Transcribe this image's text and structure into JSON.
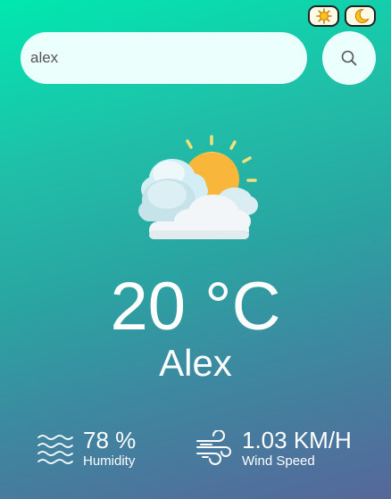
{
  "theme_toggle": {
    "light_icon": "sun-icon",
    "dark_icon": "moon-icon"
  },
  "search": {
    "value": "alex",
    "icon": "search-icon"
  },
  "weather": {
    "condition_icon": "partly-cloudy-icon",
    "temperature": "20 °C",
    "city": "Alex"
  },
  "details": {
    "humidity": {
      "value": "78 %",
      "label": "Humidity",
      "icon": "humidity-waves-icon"
    },
    "wind": {
      "value": "1.03 KM/H",
      "label": "Wind Speed",
      "icon": "wind-icon"
    }
  },
  "colors": {
    "gradient_start": "#00e8b0",
    "gradient_end": "#56679a",
    "input_background": "#ebfffc",
    "text": "#ffffff"
  }
}
